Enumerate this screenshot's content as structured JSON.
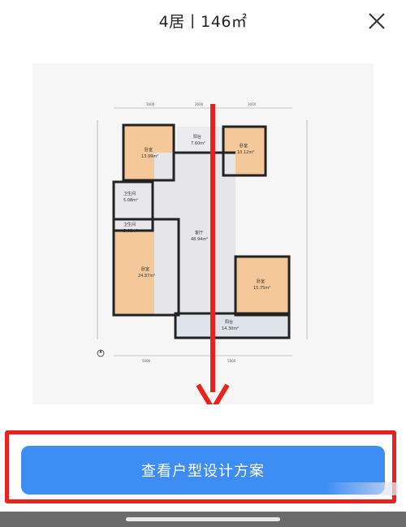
{
  "header": {
    "title": "4居丨146㎡",
    "close_icon": "close-icon"
  },
  "floor_plan": {
    "rooms": [
      {
        "name": "卧室",
        "area": "13.99m²"
      },
      {
        "name": "阳台",
        "area": "7.60m²"
      },
      {
        "name": "卧室",
        "area": "10.12m²"
      },
      {
        "name": "卫生间",
        "area": "5.08m²"
      },
      {
        "name": "卫生间",
        "area": "5.08m²"
      },
      {
        "name": "客厅",
        "area": "48.94m²"
      },
      {
        "name": "卧室",
        "area": "24.87m²"
      },
      {
        "name": "卧室",
        "area": "15.75m²"
      },
      {
        "name": "阳台",
        "area": "14.30m²"
      }
    ],
    "dimensions_top": [
      "3600",
      "2600",
      "3000"
    ],
    "dimensions_bottom": [
      "5600",
      "5500"
    ],
    "arrow_color": "#e8231f"
  },
  "cta": {
    "label": "查看户型设计方案",
    "color": "#3d8df5"
  },
  "highlight_color": "#e8231f"
}
